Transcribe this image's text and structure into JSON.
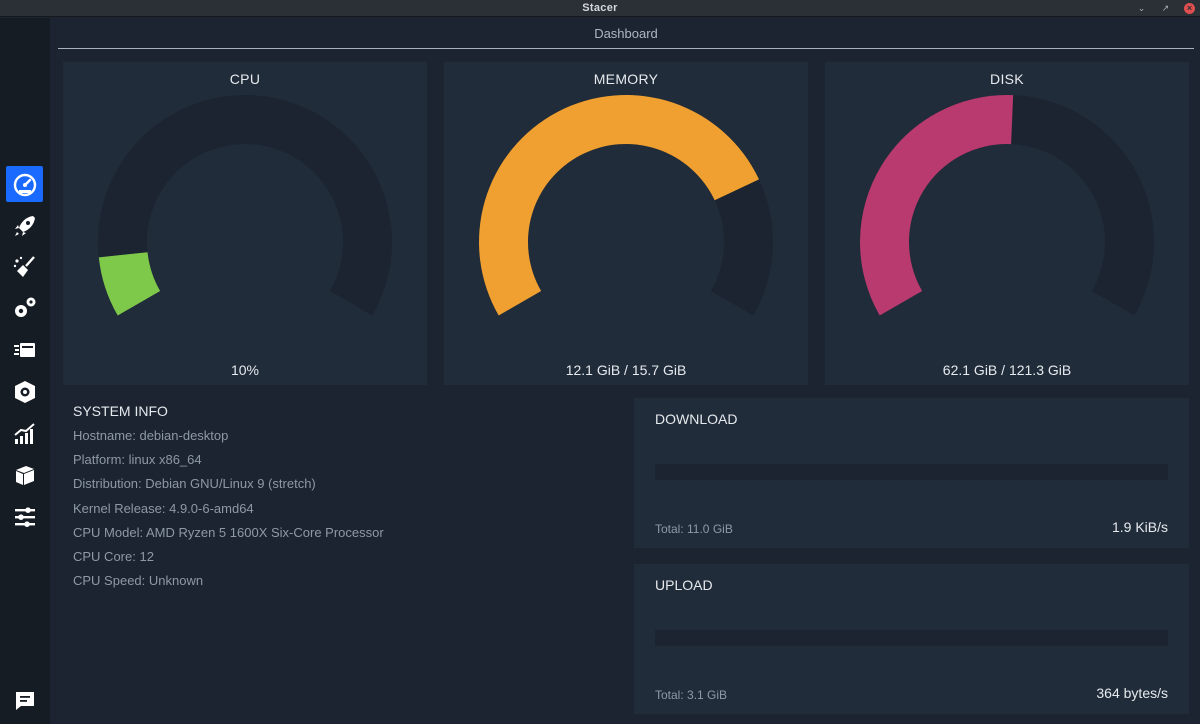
{
  "window": {
    "title": "Stacer"
  },
  "header": {
    "title": "Dashboard"
  },
  "sidebar": {
    "items": [
      {
        "name": "dashboard",
        "icon": "speedometer-icon",
        "active": true
      },
      {
        "name": "startup-apps",
        "icon": "rocket-icon",
        "active": false
      },
      {
        "name": "system-cleaner",
        "icon": "broom-icon",
        "active": false
      },
      {
        "name": "services",
        "icon": "gears-icon",
        "active": false
      },
      {
        "name": "processes",
        "icon": "processes-icon",
        "active": false
      },
      {
        "name": "uninstaller",
        "icon": "uninstall-icon",
        "active": false
      },
      {
        "name": "resources",
        "icon": "chart-icon",
        "active": false
      },
      {
        "name": "apt-repository",
        "icon": "package-icon",
        "active": false
      },
      {
        "name": "settings",
        "icon": "sliders-icon",
        "active": false
      },
      {
        "name": "feedback",
        "icon": "chat-icon",
        "active": false
      }
    ]
  },
  "gauges": {
    "cpu": {
      "title": "CPU",
      "value": "10%",
      "fraction": 0.1,
      "color": "#7ec94a"
    },
    "memory": {
      "title": "MEMORY",
      "value": "12.1 GiB / 15.7 GiB",
      "fraction": 0.77,
      "color": "#f0a030"
    },
    "disk": {
      "title": "DISK",
      "value": "62.1 GiB / 121.3 GiB",
      "fraction": 0.51,
      "color": "#b83a6e"
    }
  },
  "sysinfo": {
    "title": "SYSTEM INFO",
    "rows": [
      "Hostname: debian-desktop",
      "Platform: linux x86_64",
      "Distribution: Debian GNU/Linux 9 (stretch)",
      "Kernel Release: 4.9.0-6-amd64",
      "CPU Model:  AMD Ryzen 5 1600X Six-Core Processor",
      "CPU Core: 12",
      "CPU Speed: Unknown"
    ]
  },
  "network": {
    "download": {
      "title": "DOWNLOAD",
      "total": "Total: 11.0 GiB",
      "speed": "1.9 KiB/s"
    },
    "upload": {
      "title": "UPLOAD",
      "total": "Total: 3.1 GiB",
      "speed": "364 bytes/s"
    }
  },
  "colors": {
    "accent": "#1a6aff",
    "track": "#1b2430",
    "card": "#212c3a"
  }
}
